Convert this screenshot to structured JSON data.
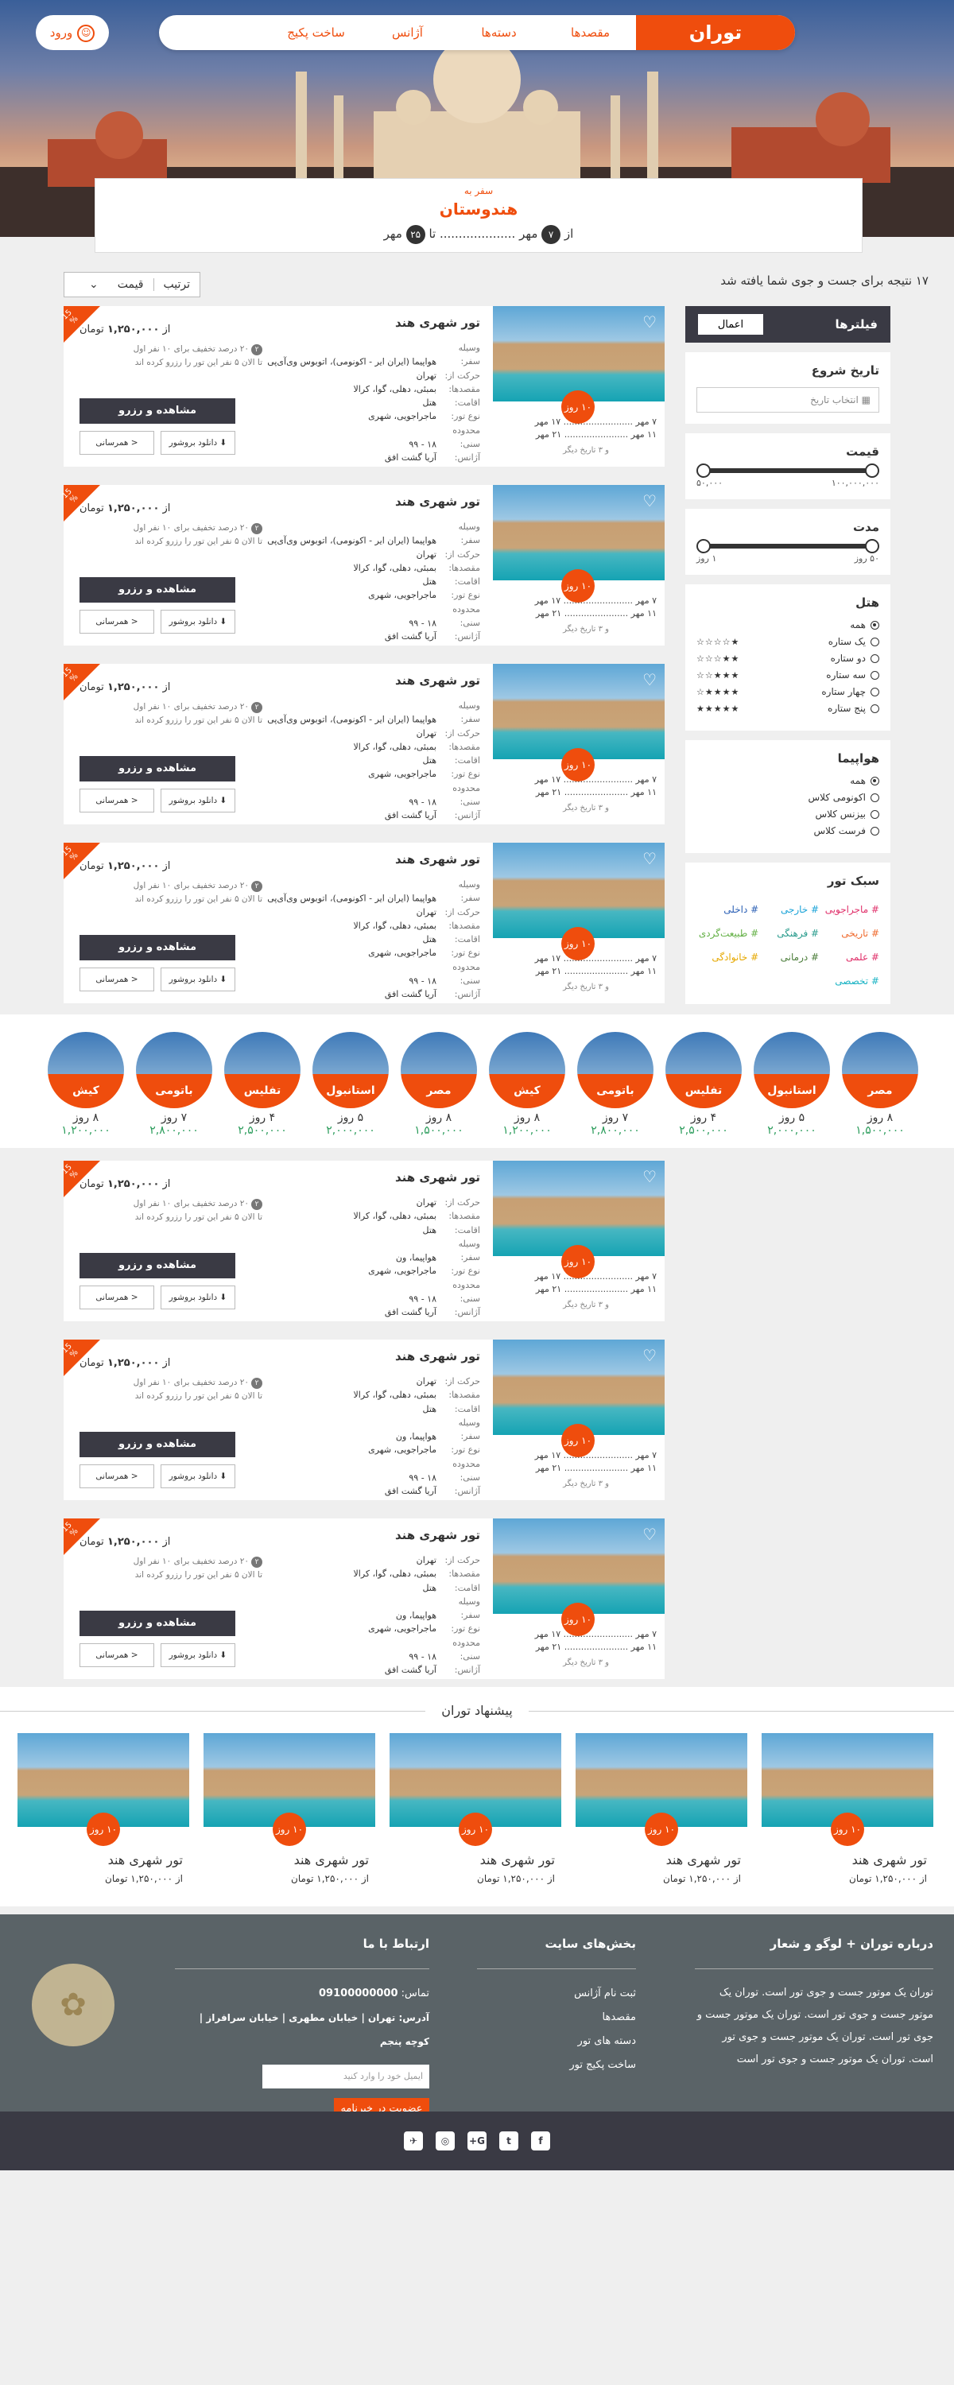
{
  "nav": {
    "brand": "توران",
    "items": [
      "مقصدها",
      "دسته‌ها",
      "آژانس",
      "ساخت پکیج"
    ],
    "login": "ورود"
  },
  "destination": {
    "subtitle": "سفر به",
    "title": "هندوستان",
    "from_label": "از",
    "from_day": "۷",
    "from_month": "مهر",
    "dots": "....................",
    "to_label": "تا",
    "to_day": "۲۵",
    "to_month": "مهر"
  },
  "results": "۱۷ نتیجه برای جست و جوی شما یافته شد",
  "sort": {
    "label": "ترتیب",
    "value": "قیمت",
    "arrow": "⌄"
  },
  "filters": {
    "title": "فیلترها",
    "apply": "اعمال",
    "date_title": "تاریخ شروع",
    "date_placeholder": "انتخاب تاریخ",
    "price_title": "قیمت",
    "price_min": "۵۰,۰۰۰",
    "price_max": "۱۰۰,۰۰۰,۰۰۰",
    "duration_title": "مدت",
    "duration_min": "۱ روز",
    "duration_max": "۵۰ روز",
    "hotel_title": "هتل",
    "hotel_options": [
      {
        "label": "همه",
        "stars": ""
      },
      {
        "label": "یک ستاره",
        "stars": "★☆☆☆☆"
      },
      {
        "label": "دو ستاره",
        "stars": "★★☆☆☆"
      },
      {
        "label": "سه ستاره",
        "stars": "★★★☆☆"
      },
      {
        "label": "چهار ستاره",
        "stars": "★★★★☆"
      },
      {
        "label": "پنج ستاره",
        "stars": "★★★★★"
      }
    ],
    "airline_title": "هواپیما",
    "airline_options": [
      "همه",
      "اکونومی کلاس",
      "بیزنس کلاس",
      "فرست کلاس"
    ],
    "style_title": "سبک تور",
    "styles": [
      {
        "label": "# ماجراجویی",
        "color": "#e0306a"
      },
      {
        "label": "# خارجی",
        "color": "#1aa3d8"
      },
      {
        "label": "# داخلی",
        "color": "#2a5fb5"
      },
      {
        "label": "# تاریخی",
        "color": "#ef6a2d"
      },
      {
        "label": "# فرهنگی",
        "color": "#2a9c8d"
      },
      {
        "label": "# طبیعت‌گردی",
        "color": "#63b045"
      },
      {
        "label": "# علمی",
        "color": "#e0306a"
      },
      {
        "label": "# درمانی",
        "color": "#4b7d3a"
      },
      {
        "label": "# خانوادگی",
        "color": "#e6a800"
      },
      {
        "label": "# تخصصی",
        "color": "#19b3c4"
      }
    ]
  },
  "tour": {
    "title": "تور شهری هند",
    "price_prefix": "از",
    "price": "۱,۲۵۰,۰۰۰",
    "currency": "تومان",
    "ribbon": "15 %",
    "discount_no": "۲",
    "discount": "۲۰ درصد تخفیف برای ۱۰ نفر اول",
    "discount2": "تا الان ۵ نفر این تور را رزرو کرده اند",
    "reserve": "مشاهده و رزرو",
    "brochure": "دانلود بروشور",
    "share": "همرسانی",
    "days_badge": "۱۰ روز",
    "date1": "۷ مهر ......................... ۱۷ مهر",
    "date2": "۱۱ مهر ....................... ۲۱ مهر",
    "more_dates": "و ۳ تاریخ دیگر",
    "info_a": [
      [
        "وسیله سفر:",
        "هواپیما (ایران ایر - اکونومی)، اتوبوس وی‌آی‌پی"
      ],
      [
        "حرکت از:",
        "تهران"
      ],
      [
        "مقصدها:",
        "بمبئی، دهلی، گوا، کرالا"
      ],
      [
        "اقامت:",
        "هتل"
      ],
      [
        "نوع تور:",
        "ماجراجویی، شهری"
      ],
      [
        "محدوده سنی:",
        "۱۸ - ۹۹"
      ],
      [
        "آژانس:",
        "آریا گشت افق"
      ]
    ],
    "info_b": [
      [
        "حرکت از:",
        "تهران"
      ],
      [
        "مقصدها:",
        "بمبئی، دهلی، گوا، کرالا"
      ],
      [
        "اقامت:",
        "هتل"
      ],
      [
        "وسیله سفر:",
        "هواپیما، ون"
      ],
      [
        "نوع تور:",
        "ماجراجویی، شهری"
      ],
      [
        "محدوده سنی:",
        "۱۸ - ۹۹"
      ],
      [
        "آژانس:",
        "آریا گشت افق"
      ]
    ]
  },
  "destinations": [
    {
      "name": "مصر",
      "days": "۸ روز",
      "price": "۱,۵۰۰,۰۰۰"
    },
    {
      "name": "استانبول",
      "days": "۵ روز",
      "price": "۲,۰۰۰,۰۰۰"
    },
    {
      "name": "تفلیس",
      "days": "۴ روز",
      "price": "۲,۵۰۰,۰۰۰"
    },
    {
      "name": "باتومی",
      "days": "۷ روز",
      "price": "۲,۸۰۰,۰۰۰"
    },
    {
      "name": "کیش",
      "days": "۸ روز",
      "price": "۱,۲۰۰,۰۰۰"
    },
    {
      "name": "مصر",
      "days": "۸ روز",
      "price": "۱,۵۰۰,۰۰۰"
    },
    {
      "name": "استانبول",
      "days": "۵ روز",
      "price": "۲,۰۰۰,۰۰۰"
    },
    {
      "name": "تفلیس",
      "days": "۴ روز",
      "price": "۲,۵۰۰,۰۰۰"
    },
    {
      "name": "باتومی",
      "days": "۷ روز",
      "price": "۲,۸۰۰,۰۰۰"
    },
    {
      "name": "کیش",
      "days": "۸ روز",
      "price": "۱,۲۰۰,۰۰۰"
    }
  ],
  "suggest": {
    "title": "پیشنهاد توران",
    "card_title": "تور شهری هند",
    "price_prefix": "از",
    "price": "۱,۲۵۰,۰۰۰",
    "currency": "تومان",
    "days": "۱۰ روز"
  },
  "footer": {
    "about_title": "درباره توران + لوگو و شعار",
    "about_text": "توران یک موتور جست و جوی تور است. توران یک موتور جست و جوی تور است. توران یک موتور جست و جوی تور است. توران یک موتور جست و جوی تور است. توران یک موتور جست و جوی تور است",
    "sections_title": "بخش‌های سایت",
    "sections": [
      "ثبت نام آژانس",
      "مقصدها",
      "دسته های تور",
      "ساخت پکیج تور"
    ],
    "contact_title": "ارتباط با ما",
    "phone_label": "تماس:",
    "phone": "09100000000",
    "address": "آدرس: تهران | خیابان مطهری | خیابان سرافراز | کوچه پنجم",
    "email_placeholder": "ایمیل خود را وارد کنید",
    "subscribe": "عضویت در خبرنامه"
  },
  "social": [
    "f",
    "t",
    "G+",
    "◎",
    "✈"
  ],
  "colors": {
    "brand": "#ef4d0d",
    "dark": "#3a3a44",
    "footer": "#5a6367"
  }
}
